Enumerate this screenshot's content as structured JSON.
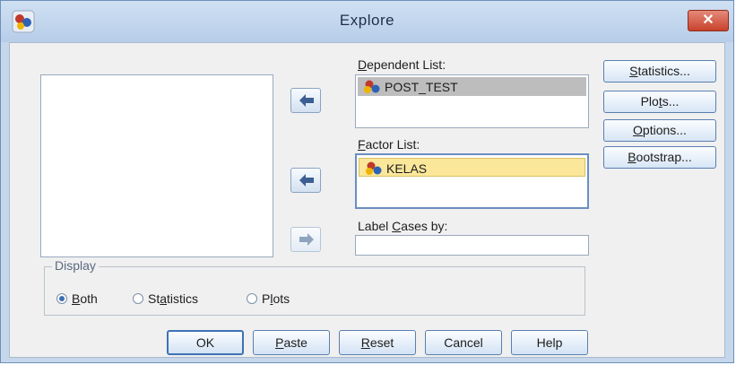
{
  "window": {
    "title": "Explore",
    "close_label": "✕"
  },
  "lists": {
    "dependent_label_prefix": "",
    "dependent_label_u": "D",
    "dependent_label_rest": "ependent List:",
    "dependent_items": [
      "POST_TEST"
    ],
    "factor_label_prefix": "",
    "factor_label_u": "F",
    "factor_label_rest": "actor List:",
    "factor_items": [
      "KELAS"
    ],
    "label_cases_prefix": "Label ",
    "label_cases_u": "C",
    "label_cases_rest": "ases by:",
    "label_cases_value": ""
  },
  "side_buttons": {
    "statistics_u": "S",
    "statistics_rest": "tatistics...",
    "plots_prefix": "Plo",
    "plots_u": "t",
    "plots_rest": "s...",
    "options_u": "O",
    "options_rest": "ptions...",
    "bootstrap_u": "B",
    "bootstrap_rest": "ootstrap..."
  },
  "display": {
    "legend": "Display",
    "both_u": "B",
    "both_rest": "oth",
    "statistics_prefix": "St",
    "statistics_u": "a",
    "statistics_rest": "tistics",
    "plots_prefix": "P",
    "plots_u": "l",
    "plots_rest": "ots",
    "selected": "Both"
  },
  "bottom_buttons": {
    "ok": "OK",
    "paste_u": "P",
    "paste_rest": "aste",
    "reset_u": "R",
    "reset_rest": "eset",
    "cancel": "Cancel",
    "help": "Help"
  },
  "icons": {
    "app": "spss-app-icon",
    "variable": "nominal-variable-icon",
    "move_arrow": "move-arrow-icon"
  }
}
